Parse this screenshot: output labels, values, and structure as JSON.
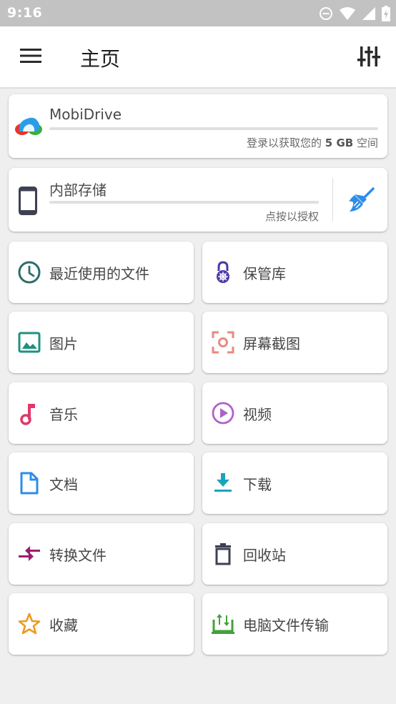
{
  "status_bar": {
    "time": "9:16"
  },
  "app_bar": {
    "title": "主页"
  },
  "mobidrive": {
    "name": "MobiDrive",
    "hint_prefix": "登录以获取您的",
    "hint_bold": "5 GB",
    "hint_suffix": "空间"
  },
  "internal_storage": {
    "name": "内部存储",
    "hint": "点按以授权"
  },
  "tiles": [
    {
      "label": "最近使用的文件",
      "icon": "clock-icon",
      "color": "#2b6e6b"
    },
    {
      "label": "保管库",
      "icon": "vault-lock-icon",
      "color": "#4a3aa8"
    },
    {
      "label": "图片",
      "icon": "image-icon",
      "color": "#21907f"
    },
    {
      "label": "屏幕截图",
      "icon": "screenshot-icon",
      "color": "#e88a80"
    },
    {
      "label": "音乐",
      "icon": "music-note-icon",
      "color": "#e2376a"
    },
    {
      "label": "视频",
      "icon": "video-play-icon",
      "color": "#b062c9"
    },
    {
      "label": "文档",
      "icon": "document-icon",
      "color": "#2e8de8"
    },
    {
      "label": "下载",
      "icon": "download-icon",
      "color": "#1aa4b9"
    },
    {
      "label": "转换文件",
      "icon": "convert-arrows-icon",
      "color": "#9a1d73"
    },
    {
      "label": "回收站",
      "icon": "trash-icon",
      "color": "#3d4152"
    },
    {
      "label": "收藏",
      "icon": "star-icon",
      "color": "#ee9b1f"
    },
    {
      "label": "电脑文件传输",
      "icon": "pc-transfer-icon",
      "color": "#44a13a"
    }
  ]
}
